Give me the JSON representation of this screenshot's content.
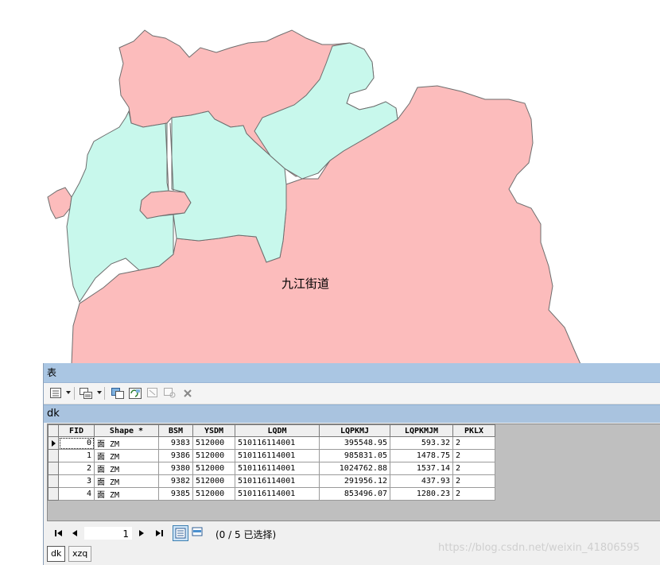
{
  "map": {
    "label": "九江街道",
    "colors": {
      "pink": "#fcbcbc",
      "mint": "#c8f8ec",
      "outline": "#6e6e6e"
    }
  },
  "table_window": {
    "title": "表",
    "layer_tab": "dk",
    "columns": [
      "FID",
      "Shape *",
      "BSM",
      "YSDM",
      "LQDM",
      "LQPKMJ",
      "LQPKMJM",
      "PKLX"
    ],
    "rows": [
      [
        "0",
        "面 ZM",
        "9383",
        "512000",
        "510116114001",
        "395548.95",
        "593.32",
        "2"
      ],
      [
        "1",
        "面 ZM",
        "9386",
        "512000",
        "510116114001",
        "985831.05",
        "1478.75",
        "2"
      ],
      [
        "2",
        "面 ZM",
        "9380",
        "512000",
        "510116114001",
        "1024762.88",
        "1537.14",
        "2"
      ],
      [
        "3",
        "面 ZM",
        "9382",
        "512000",
        "510116114001",
        "291956.12",
        "437.93",
        "2"
      ],
      [
        "4",
        "面 ZM",
        "9385",
        "512000",
        "510116114001",
        "853496.07",
        "1280.23",
        "2"
      ]
    ],
    "navigation": {
      "current_record": "1",
      "selection_status": "(0 / 5 已选择)"
    },
    "bottom_tabs": [
      "dk",
      "xzq"
    ],
    "watermark": "https://blog.csdn.net/weixin_41806595"
  }
}
